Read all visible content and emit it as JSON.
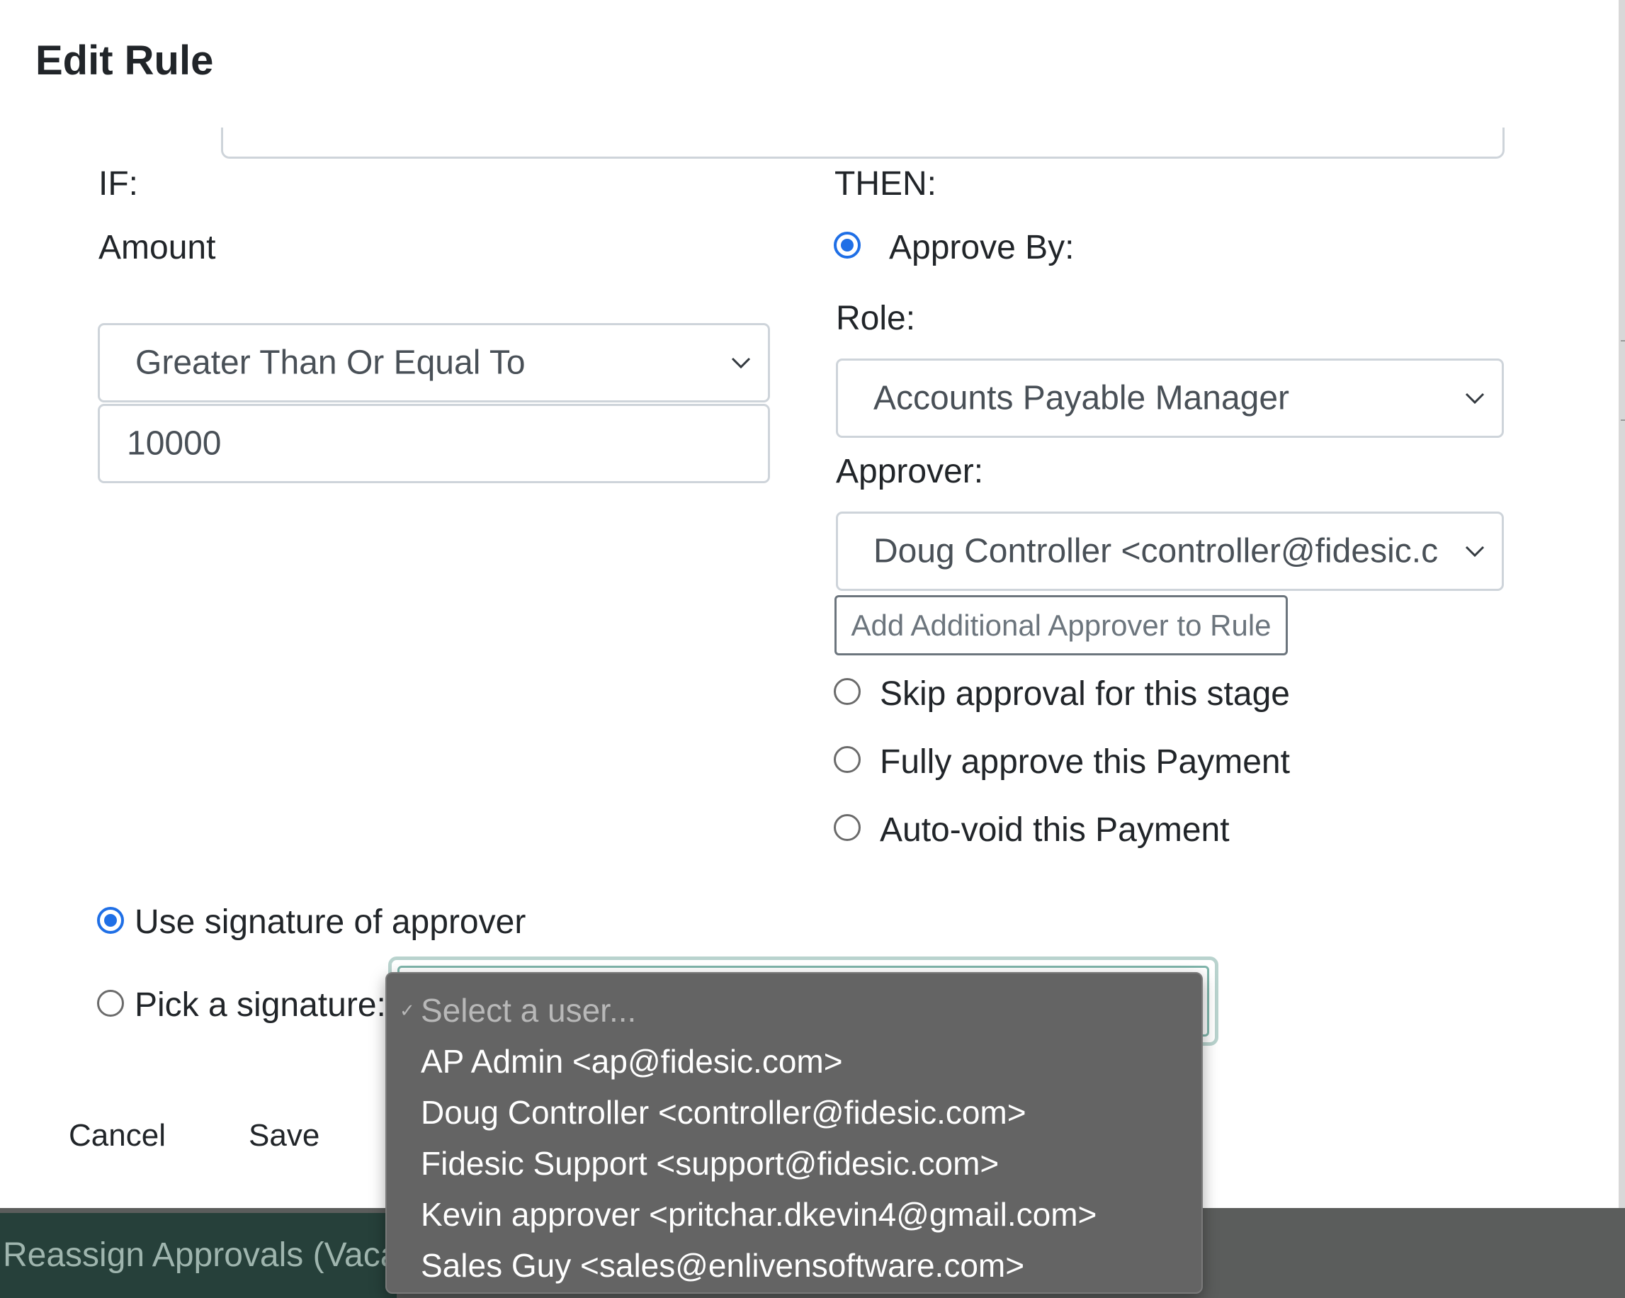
{
  "background": {
    "nav_label": "Reassign Approvals (Vaca"
  },
  "modal": {
    "title": "Edit Rule",
    "if_section": {
      "heading": "IF:",
      "field_label": "Amount",
      "operator_select": "Greater Than Or Equal To",
      "amount_value": "10000"
    },
    "then_section": {
      "heading": "THEN:",
      "approve_by_label": "Approve By:",
      "approve_by_checked": true,
      "role_label": "Role:",
      "role_select": "Accounts Payable Manager",
      "approver_label": "Approver:",
      "approver_select": "Doug Controller <controller@fidesic.c",
      "add_approver_button": "Add Additional Approver to Rule",
      "options": [
        {
          "label": "Skip approval for this stage",
          "checked": false
        },
        {
          "label": "Fully approve this Payment",
          "checked": false
        },
        {
          "label": "Auto-void this Payment",
          "checked": false
        }
      ]
    },
    "signature": {
      "use_approver_label": "Use signature of approver",
      "use_approver_checked": true,
      "pick_label": "Pick a signature:",
      "pick_checked": false
    },
    "footer": {
      "cancel_label": "Cancel",
      "save_label": "Save"
    }
  },
  "dropdown": {
    "check_mark": "✓",
    "placeholder": "Select a user...",
    "items": [
      "AP Admin <ap@fidesic.com>",
      "Doug Controller <controller@fidesic.com>",
      "Fidesic Support <support@fidesic.com>",
      "Kevin approver <pritchar.dkevin4@gmail.com>",
      "Sales Guy <sales@enlivensoftware.com>"
    ]
  },
  "colors": {
    "accent": "#1f6fe6",
    "dropdown_bg": "#646464",
    "nav_bg": "#26403a"
  }
}
